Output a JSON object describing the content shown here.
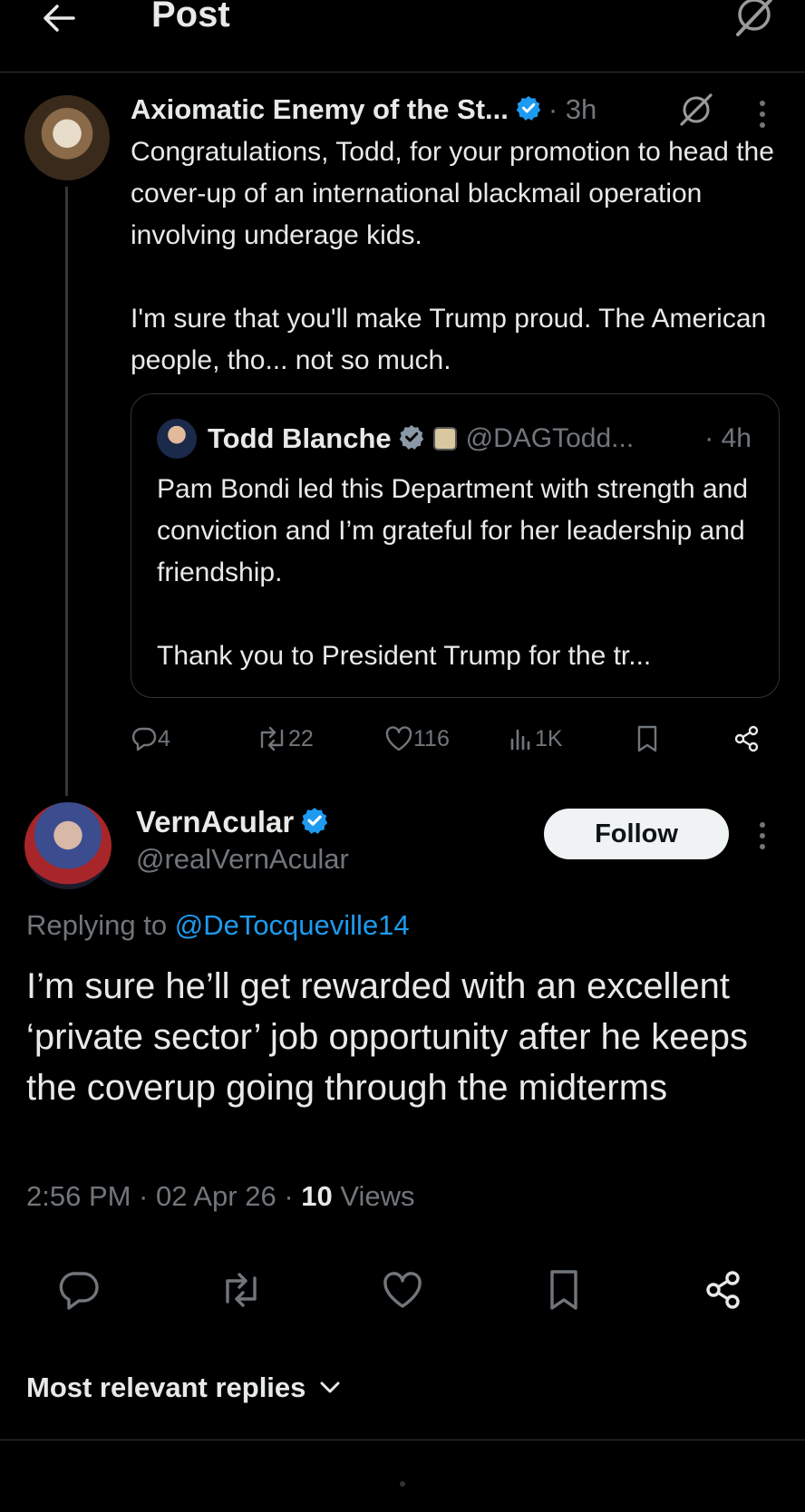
{
  "header": {
    "title": "Post"
  },
  "parent_tweet": {
    "author_name": "Axiomatic Enemy of the St...",
    "time": "· 3h",
    "text_paragraph_1": "Congratulations, Todd, for your promotion to head the cover-up of an international blackmail operation involving underage kids.",
    "text_paragraph_2": "I'm sure that you'll make Trump proud. The American people, tho... not so much.",
    "quote": {
      "author_name": "Todd Blanche",
      "handle": "@DAGTodd...",
      "time": "· 4h",
      "text_paragraph_1": "Pam Bondi led this Department with strength and conviction and I’m grateful for her leadership and friendship.",
      "text_paragraph_2": "Thank you to President Trump for the tr..."
    },
    "stats": {
      "replies": "4",
      "reposts": "22",
      "likes": "116",
      "views": "1K"
    }
  },
  "reply_tweet": {
    "author_name": "VernAcular",
    "handle": "@realVernAcular",
    "follow_label": "Follow",
    "replying_prefix": "Replying to",
    "replying_handle": "@DeTocqueville14",
    "text": "I’m sure he’ll get rewarded with an excellent ‘private sector’ job opportunity after he keeps the coverup going through the midterms",
    "time": "2:56 PM · 02 Apr 26 · ",
    "views_count": "10",
    "views_label": " Views"
  },
  "replies_sort": {
    "label": "Most relevant replies"
  },
  "colors": {
    "background": "#000000",
    "text": "#e7e9ea",
    "secondary": "#71767b",
    "accent": "#1d9bf0",
    "border": "#2f3336"
  },
  "icons": [
    "back-arrow-icon",
    "grok-icon",
    "verified-badge-icon",
    "more-icon",
    "reply-icon",
    "repost-icon",
    "like-icon",
    "views-icon",
    "bookmark-icon",
    "share-icon",
    "chevron-down-icon"
  ]
}
